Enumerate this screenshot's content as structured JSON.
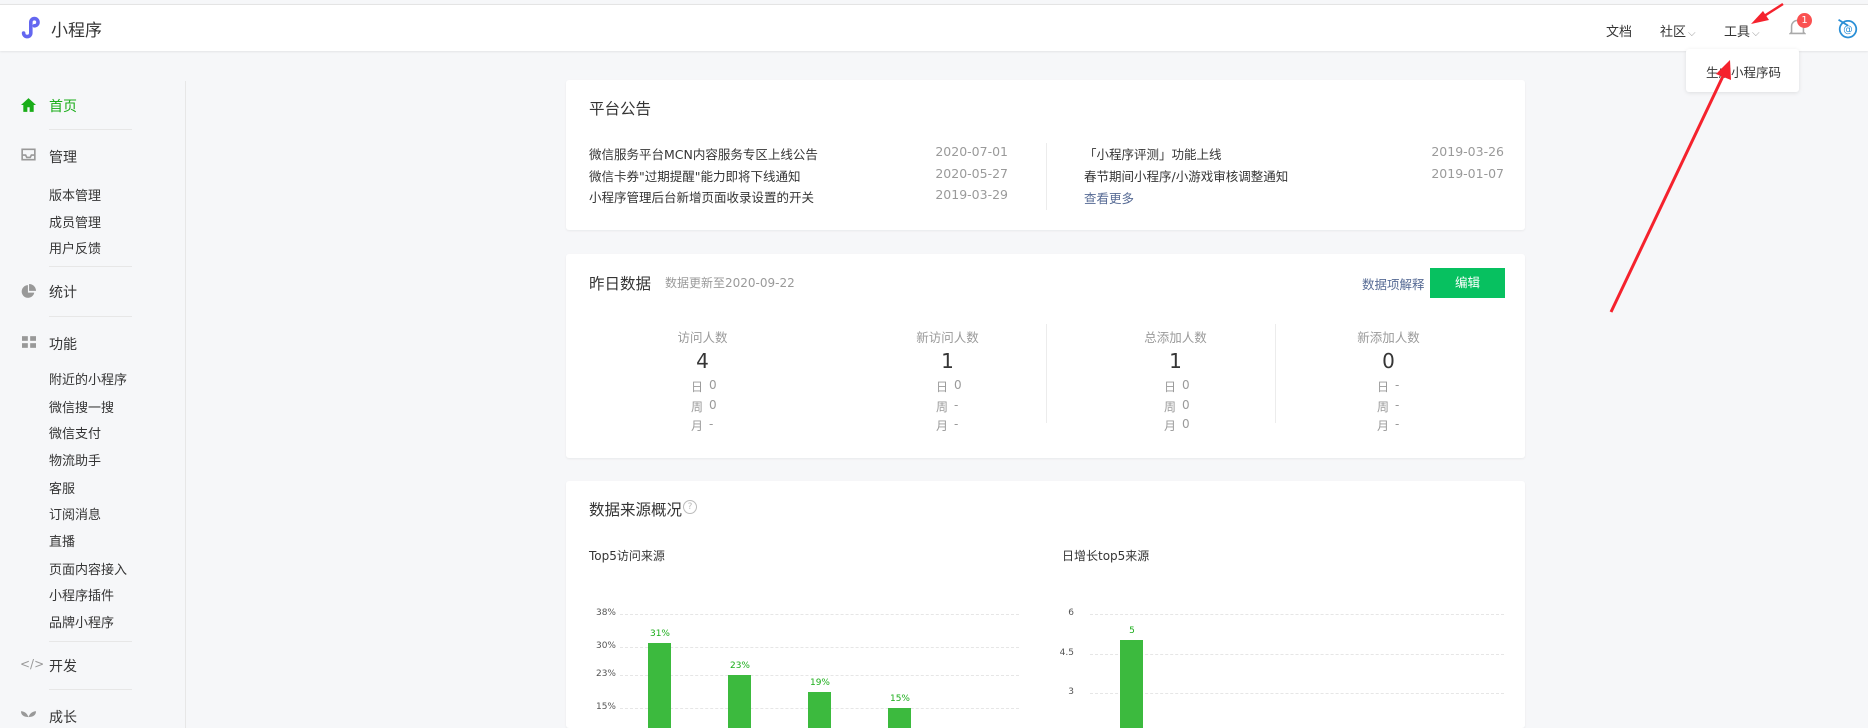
{
  "app": {
    "title": "小程序"
  },
  "topnav": {
    "docs": "文档",
    "community": "社区",
    "tools": "工具",
    "notification_count": "1"
  },
  "tools_dropdown": {
    "items": [
      "生成小程序码"
    ]
  },
  "sidebar": {
    "home": "首页",
    "manage": "管理",
    "manage_items": [
      "版本管理",
      "成员管理",
      "用户反馈"
    ],
    "stats": "统计",
    "features": "功能",
    "features_items": [
      "附近的小程序",
      "微信搜一搜",
      "微信支付",
      "物流助手",
      "客服",
      "订阅消息",
      "直播",
      "页面内容接入",
      "小程序插件",
      "品牌小程序"
    ],
    "develop": "开发",
    "growth": "成长"
  },
  "announcements": {
    "title": "平台公告",
    "left": [
      {
        "text": "微信服务平台MCN内容服务专区上线公告",
        "date": "2020-07-01"
      },
      {
        "text": "微信卡券\"过期提醒\"能力即将下线通知",
        "date": "2020-05-27"
      },
      {
        "text": "小程序管理后台新增页面收录设置的开关",
        "date": "2019-03-29"
      }
    ],
    "right": [
      {
        "text": "「小程序评测」功能上线",
        "date": "2019-03-26"
      },
      {
        "text": "春节期间小程序/小游戏审核调整通知",
        "date": "2019-01-07"
      }
    ],
    "more": "查看更多"
  },
  "yesterday": {
    "title": "昨日数据",
    "updated": "数据更新至2020-09-22",
    "explain": "数据项解释",
    "edit": "编辑",
    "row_labels": [
      "日",
      "周",
      "月"
    ],
    "stats": [
      {
        "label": "访问人数",
        "value": "4",
        "rows": [
          "0",
          "0",
          "-"
        ]
      },
      {
        "label": "新访问人数",
        "value": "1",
        "rows": [
          "0",
          "-",
          "-"
        ]
      },
      {
        "label": "总添加人数",
        "value": "1",
        "rows": [
          "0",
          "0",
          "0"
        ]
      },
      {
        "label": "新添加人数",
        "value": "0",
        "rows": [
          "-",
          "-",
          "-"
        ]
      }
    ]
  },
  "sources": {
    "title": "数据来源概况",
    "help": "?"
  },
  "colors": {
    "accent": "#1aad19",
    "button": "#07c160",
    "bar": "#3cba3e",
    "link": "#576b95",
    "badge": "#fa5151",
    "arrow": "#f5222d"
  },
  "chart_data": [
    {
      "type": "bar",
      "title": "Top5访问来源",
      "yticks": [
        "38%",
        "30%",
        "23%",
        "15%"
      ],
      "ytick_values": [
        38,
        30,
        23,
        15
      ],
      "values": [
        31,
        23,
        19,
        15
      ],
      "value_labels": [
        "31%",
        "23%",
        "19%",
        "15%"
      ],
      "ylim": [
        0,
        38
      ]
    },
    {
      "type": "bar",
      "title": "日增长top5来源",
      "yticks": [
        "6",
        "4.5",
        "3"
      ],
      "ytick_values": [
        6,
        4.5,
        3
      ],
      "values": [
        5
      ],
      "value_labels": [
        "5"
      ],
      "ylim": [
        0,
        6
      ]
    }
  ]
}
